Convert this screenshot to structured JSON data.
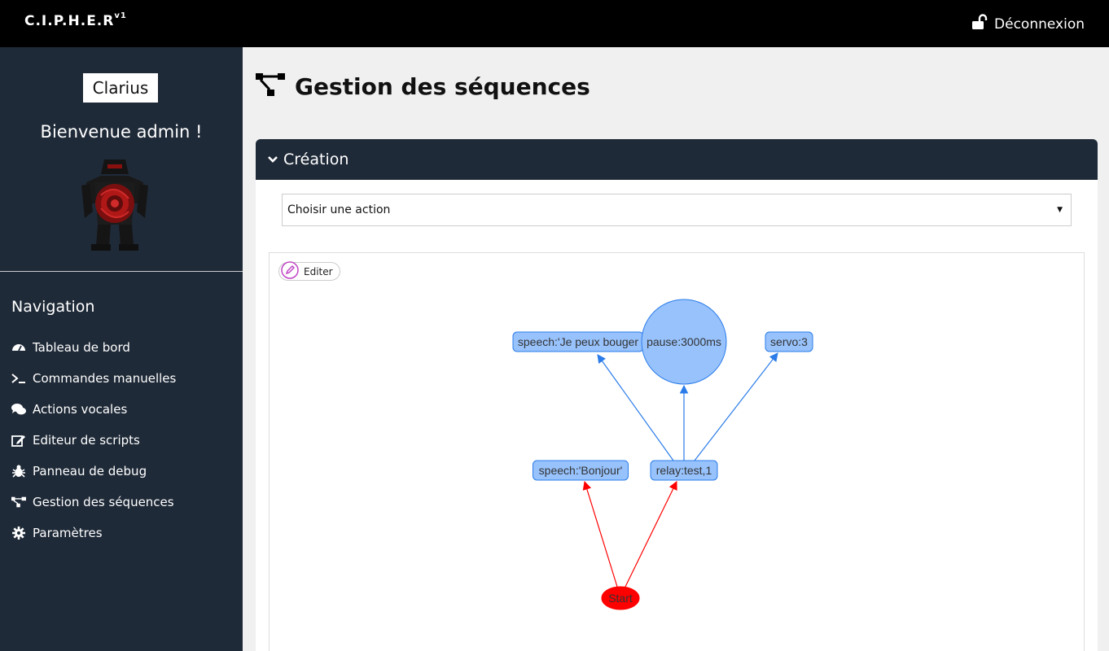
{
  "topbar": {
    "brand": "C.I.P.H.E.R",
    "brand_version": "v1",
    "logout_label": "Déconnexion"
  },
  "sidebar": {
    "robot_name": "Clarius",
    "welcome": "Bienvenue admin !",
    "nav_title": "Navigation",
    "items": [
      {
        "label": "Tableau de bord",
        "icon": "dashboard-icon"
      },
      {
        "label": "Commandes manuelles",
        "icon": "terminal-icon"
      },
      {
        "label": "Actions vocales",
        "icon": "comments-icon"
      },
      {
        "label": "Editeur de scripts",
        "icon": "edit-icon"
      },
      {
        "label": "Panneau de debug",
        "icon": "bug-icon"
      },
      {
        "label": "Gestion des séquences",
        "icon": "sitemap-icon"
      },
      {
        "label": "Paramètres",
        "icon": "gear-icon"
      }
    ]
  },
  "main": {
    "page_title": "Gestion des séquences",
    "panel_title": "Création",
    "select_value": "Choisir une action",
    "edit_label": "Editer",
    "graph": {
      "nodes": [
        {
          "id": "start",
          "label": "Start",
          "color": "#ff0000"
        },
        {
          "id": "speech_bonjour",
          "label": "speech:'Bonjour'",
          "color": "#97c2fc"
        },
        {
          "id": "relay",
          "label": "relay:test,1",
          "color": "#97c2fc"
        },
        {
          "id": "speech_bouger",
          "label": "speech:'Je peux bouger",
          "color": "#97c2fc"
        },
        {
          "id": "pause",
          "label": "pause:3000ms",
          "color": "#97c2fc"
        },
        {
          "id": "servo",
          "label": "servo:3",
          "color": "#97c2fc"
        }
      ],
      "edges": [
        {
          "from": "start",
          "to": "speech_bonjour",
          "color": "#ff0000"
        },
        {
          "from": "start",
          "to": "relay",
          "color": "#ff0000"
        },
        {
          "from": "relay",
          "to": "speech_bouger",
          "color": "#2b7ce9"
        },
        {
          "from": "relay",
          "to": "pause",
          "color": "#2b7ce9"
        },
        {
          "from": "relay",
          "to": "servo",
          "color": "#2b7ce9"
        }
      ]
    }
  }
}
